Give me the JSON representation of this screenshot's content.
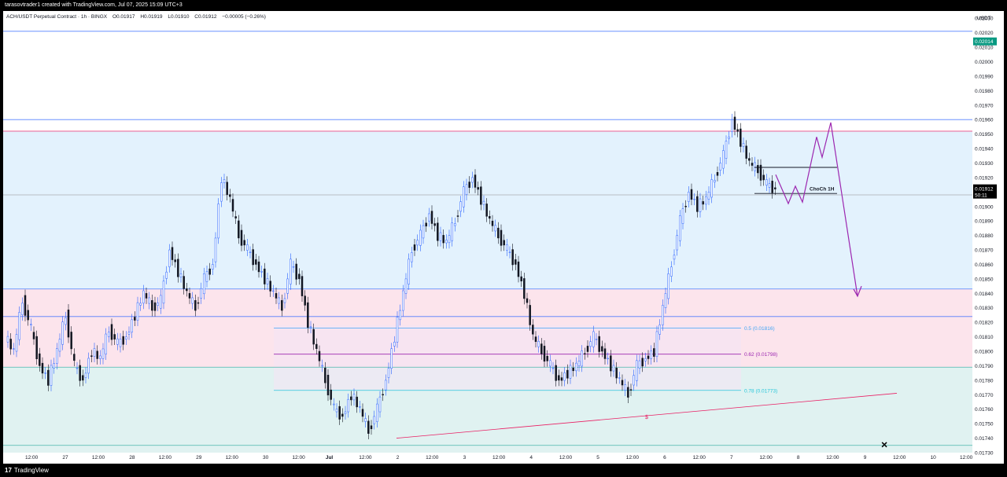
{
  "header": {
    "watermark": "tarasovtrader1 created with TradingView.com, Jul 07, 2025 15:09 UTC+3"
  },
  "footer": {
    "logo": "17",
    "brand": "TradingView"
  },
  "legend": {
    "symbol": "ACH/USDT Perpetual Contract · 1h · BINGX",
    "open": "O0.01917",
    "high": "H0.01919",
    "low": "L0.01910",
    "close": "C0.01912",
    "change": "−0.00005 (−0.26%)"
  },
  "colors": {
    "bull": "#2962ff",
    "bear": "#131722",
    "fib_05": "#42a5f5",
    "fib_062": "#9c27b0",
    "fib_078": "#26c6da",
    "projection": "#9c27b0",
    "trendline": "#e91e63",
    "current_price_tag": "#089981"
  },
  "chart_data": {
    "type": "candlestick",
    "currency": "USDT",
    "price_axis_ticks": [
      "0.02030",
      "0.02020",
      "0.02010",
      "0.02000",
      "0.01990",
      "0.01980",
      "0.01970",
      "0.01960",
      "0.01950",
      "0.01940",
      "0.01930",
      "0.01920",
      "0.01910",
      "0.01900",
      "0.01890",
      "0.01880",
      "0.01870",
      "0.01860",
      "0.01850",
      "0.01840",
      "0.01830",
      "0.01820",
      "0.01810",
      "0.01800",
      "0.01790",
      "0.01780",
      "0.01770",
      "0.01760",
      "0.01750",
      "0.01740",
      "0.01730"
    ],
    "price_range": [
      0.0173,
      0.02035
    ],
    "time_axis_ticks": [
      "12:00",
      "27",
      "12:00",
      "28",
      "12:00",
      "29",
      "12:00",
      "30",
      "12:00",
      "Jul",
      "12:00",
      "2",
      "12:00",
      "3",
      "12:00",
      "4",
      "12:00",
      "5",
      "12:00",
      "6",
      "12:00",
      "7",
      "12:00",
      "8",
      "12:00",
      "9",
      "12:00",
      "10",
      "12:00"
    ],
    "last_price": "0.01912",
    "countdown": "50:11",
    "upper_price_tag": "0.02014",
    "horizontal_levels": [
      0.02021,
      0.0196,
      0.01952,
      0.01908,
      0.01843,
      0.01824,
      0.01789,
      0.01735
    ],
    "zones": [
      {
        "from": 0.01952,
        "to": 0.01843,
        "color": "#e3f2fd"
      },
      {
        "from": 0.01843,
        "to": 0.01789,
        "color": "#fce4ec"
      },
      {
        "from": 0.01789,
        "to": 0.0173,
        "color": "#e0f2f1"
      }
    ],
    "fib_levels": [
      {
        "label": "0.5 (0.01816)",
        "value": 0.01816
      },
      {
        "label": "0.62 (0.01798)",
        "value": 0.01798
      },
      {
        "label": "0.78 (0.01773)",
        "value": 0.01773
      }
    ],
    "annotations": {
      "choch_label": "ChoCh 1H",
      "liquidity_label": "$",
      "target_marker": "×"
    },
    "price_path": [
      0.0181,
      0.018,
      0.01835,
      0.01815,
      0.0179,
      0.0178,
      0.018,
      0.01825,
      0.0179,
      0.0178,
      0.018,
      0.01795,
      0.01815,
      0.01805,
      0.0181,
      0.01825,
      0.0184,
      0.0183,
      0.01835,
      0.0187,
      0.01855,
      0.0184,
      0.0183,
      0.0185,
      0.0186,
      0.0192,
      0.01905,
      0.0188,
      0.0187,
      0.0186,
      0.0185,
      0.0184,
      0.0183,
      0.0186,
      0.0185,
      0.0182,
      0.018,
      0.0178,
      0.0176,
      0.01755,
      0.0177,
      0.0176,
      0.01745,
      0.0176,
      0.0178,
      0.0181,
      0.0184,
      0.0187,
      0.0188,
      0.01895,
      0.0188,
      0.01875,
      0.0189,
      0.0191,
      0.0192,
      0.01905,
      0.0189,
      0.0188,
      0.0187,
      0.0186,
      0.0184,
      0.0181,
      0.018,
      0.0179,
      0.0178,
      0.01785,
      0.0179,
      0.018,
      0.0181,
      0.018,
      0.0179,
      0.0178,
      0.0177,
      0.0179,
      0.01795,
      0.018,
      0.0183,
      0.0186,
      0.0189,
      0.0191,
      0.019,
      0.01905,
      0.0192,
      0.01935,
      0.0196,
      0.01945,
      0.0193,
      0.01925,
      0.01915,
      0.01912
    ]
  }
}
